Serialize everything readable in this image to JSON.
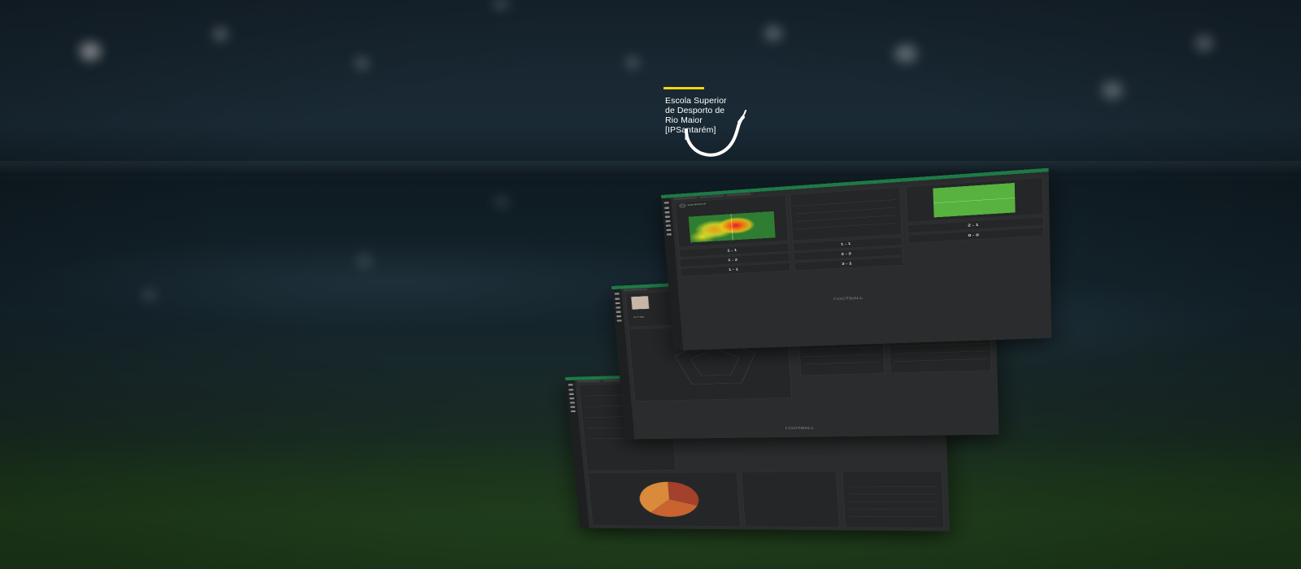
{
  "brand": {
    "accent_color": "#f4d414",
    "lines": [
      "Escola Superior",
      "de Desporto de",
      "Rio Maior"
    ],
    "tagline": "[IPSantarém]"
  },
  "app": {
    "theme_color": "#1d7a46",
    "footer_logo": "FOOTBALL"
  },
  "front": {
    "header": "Liga Nacional",
    "matches": [
      {
        "score": "1 - 1"
      },
      {
        "score": "1 - 1"
      },
      {
        "score": "2 - 1"
      },
      {
        "score": "1 - 2"
      },
      {
        "score": "2 - 2"
      },
      {
        "score": "1 - 1"
      },
      {
        "score": "3 - 1"
      },
      {
        "score": "0 - 0"
      }
    ]
  },
  "middle": {
    "player_label": "Average"
  }
}
